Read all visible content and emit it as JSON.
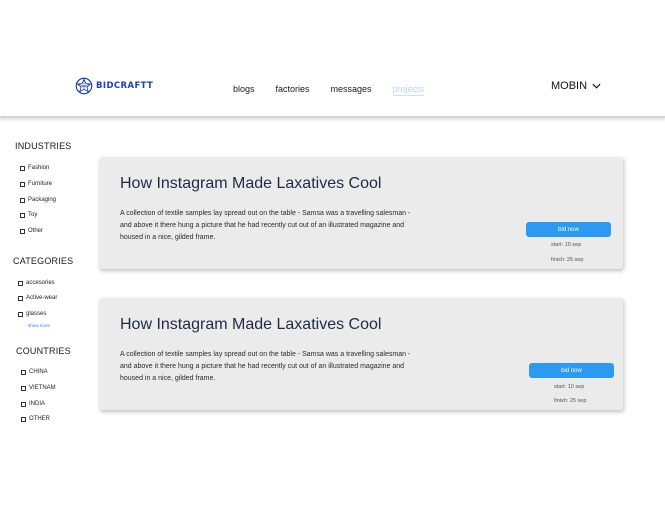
{
  "brand": {
    "name": "BIDCRAFTT",
    "color": "#1b3fb8"
  },
  "nav": {
    "blogs": "blogs",
    "factories": "factories",
    "messages": "messages",
    "projects": "projects"
  },
  "user": {
    "name": "MOBIN"
  },
  "sidebar": {
    "industries": {
      "title": "INDUSTRIES",
      "items": [
        "Fashion",
        "Furniture",
        "Packaging",
        "Toy",
        "Other"
      ]
    },
    "categories": {
      "title": "CATEGORIES",
      "items": [
        "accesories",
        "Active-wear",
        "glasses"
      ],
      "show_more": "show more"
    },
    "countries": {
      "title": "COUNTRIES",
      "items": [
        "CHINA",
        "VIETNAM",
        "INDIA",
        "OTHER"
      ]
    }
  },
  "projects": [
    {
      "title": "How Instagram Made Laxatives Cool",
      "description": "A collection of textile samples lay spread out on the table - Samsa was a travelling salesman - and above it there hung a picture that he had recently cut out of an illustrated magazine and housed in a nice, gilded frame.",
      "bid_label": "bid now",
      "start": "start: 10 sep",
      "finish": "finish: 25 sep"
    },
    {
      "title": "How Instagram Made Laxatives Cool",
      "description": "A collection of textile samples lay spread out on the table - Samsa was a travelling salesman - and above it there hung a picture that he had recently cut out of an illustrated magazine and housed in a nice, gilded frame.",
      "bid_label": "bid now",
      "start": "start: 10 sep",
      "finish": "finish: 25 sep"
    }
  ],
  "colors": {
    "accent": "#2c9af2",
    "active_nav": "#bcd4f5",
    "card_bg": "#ebebeb"
  },
  "icons": {
    "logo": "geometric-star-logo-icon",
    "user_menu": "chevron-down-icon",
    "checkbox": "checkbox-icon"
  }
}
